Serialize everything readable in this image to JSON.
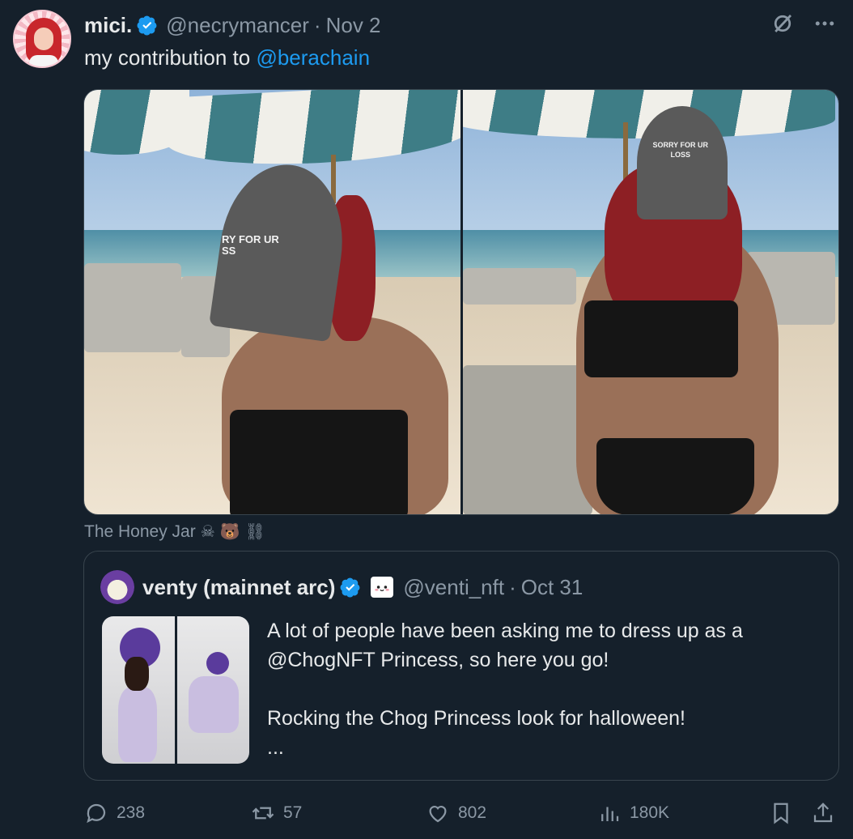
{
  "post": {
    "author": {
      "display_name": "mici.",
      "handle": "@necrymancer",
      "separator": "·",
      "date": "Nov 2"
    },
    "text_prefix": "my contribution to ",
    "mention": "@berachain",
    "caption_text": "The Honey Jar",
    "caption_emojis": [
      "☠",
      "🐻",
      "⛓"
    ],
    "photo_left_cap_text": "RY FOR UR\nSS",
    "photo_right_cap_text": "SORRY FOR UR\nLOSS"
  },
  "quote": {
    "display_name": "venty (mainnet arc)",
    "handle": "@venti_nft",
    "separator": "·",
    "date": "Oct 31",
    "lines": [
      "A lot of people have been asking me to dress up as a",
      "@ChogNFT Princess, so here you go!",
      "",
      "Rocking the Chog Princess look for halloween!",
      "..."
    ]
  },
  "actions": {
    "replies": "238",
    "reposts": "57",
    "likes": "802",
    "views": "180K"
  },
  "colors": {
    "accent": "#1d9bf0",
    "background": "#15202b",
    "muted": "#8b98a5",
    "verified": "#1d9bf0"
  },
  "icons": [
    "verified-icon",
    "grok-slash-icon",
    "more-icon",
    "reply-icon",
    "repost-icon",
    "like-icon",
    "views-icon",
    "bookmark-icon",
    "share-icon"
  ]
}
